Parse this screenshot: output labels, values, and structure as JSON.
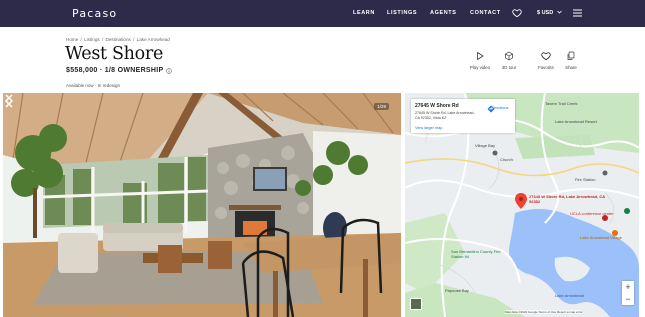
{
  "nav": {
    "brand": "Pacaso",
    "links": [
      "LEARN",
      "LISTINGS",
      "AGENTS",
      "CONTACT"
    ],
    "currency": "$ USD"
  },
  "breadcrumb": [
    "Home",
    "Listings",
    "Destinations",
    "Lake Arrowhead"
  ],
  "listing": {
    "title": "West Shore",
    "price_line": "$558,000 · 1/8 OWNERSHIP",
    "availability": "Available now · In redesign"
  },
  "actions": [
    {
      "label": "Play video",
      "icon": "play-icon"
    },
    {
      "label": "3D tour",
      "icon": "cube-icon"
    },
    {
      "label": "Favorite",
      "icon": "heart-icon"
    },
    {
      "label": "Share",
      "icon": "share-icon"
    }
  ],
  "photo": {
    "counter": "1/29"
  },
  "map": {
    "card_title": "27645 W Shore Rd",
    "card_address": "27645 W Shore Rd, Lake Arrowhead, CA 92352, Vista KZ",
    "card_link": "View larger map",
    "directions": "Directions",
    "pin_label": "27645 W Shore Rd, Lake Arrowhead, CA 92352",
    "labels": {
      "trail": "Tavern Trail Creek",
      "complex": "Lake Arrowhead Resort",
      "place1": "Village Bay",
      "church": "Church",
      "fire": "Fire Station",
      "county": "San Bernardino County Fire Station 94",
      "lake": "Lake Arrowhead",
      "conference": "UCLA conference center",
      "village": "Lake Arrowhead Village",
      "point": "Papoose Bay"
    },
    "footer": "Map data ©2022 Google   Terms of Use   Report a map error",
    "zoom_in": "+",
    "zoom_out": "−"
  },
  "colors": {
    "nav_bg": "#2d2a4a",
    "lake": "#9cc0f9",
    "pin": "#ea4335"
  }
}
